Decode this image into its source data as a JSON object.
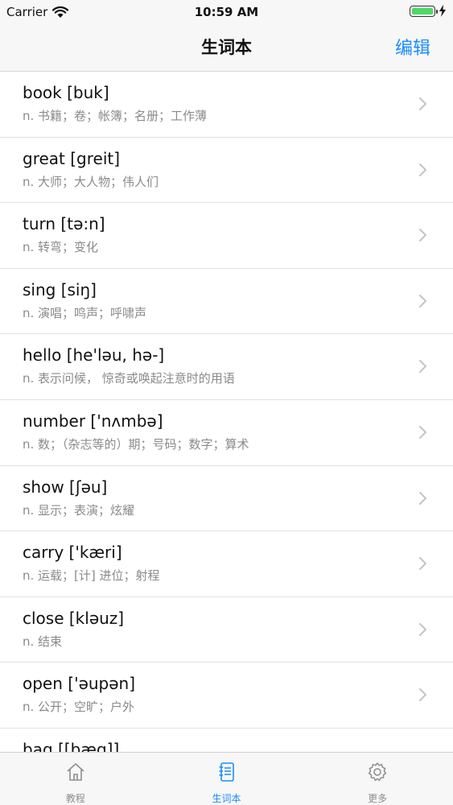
{
  "status_bar": {
    "carrier": "Carrier",
    "time": "10:59 AM"
  },
  "nav": {
    "title": "生词本",
    "edit_label": "编辑"
  },
  "words": [
    {
      "word": "book [buk]",
      "definition": "n. 书籍；卷；帐簿；名册；工作薄"
    },
    {
      "word": "great [greit]",
      "definition": "n. 大师；大人物；伟人们"
    },
    {
      "word": "turn [tə:n]",
      "definition": "n. 转弯；变化"
    },
    {
      "word": "sing [siŋ]",
      "definition": "n. 演唱；鸣声；呼啸声"
    },
    {
      "word": "hello [he'ləu, hə-]",
      "definition": "n. 表示问候， 惊奇或唤起注意时的用语"
    },
    {
      "word": "number ['nʌmbə]",
      "definition": "n. 数；（杂志等的）期；号码；数字；算术"
    },
    {
      "word": "show [ʃəu]",
      "definition": "n. 显示；表演；炫耀"
    },
    {
      "word": "carry ['kæri]",
      "definition": "n. 运载；[计] 进位；射程"
    },
    {
      "word": "close [kləuz]",
      "definition": "n. 结束"
    },
    {
      "word": "open ['əupən]",
      "definition": "n. 公开；空旷；户外"
    },
    {
      "word": "bag [[bæg]]",
      "definition": ""
    }
  ],
  "tabs": [
    {
      "label": "教程",
      "icon": "home-icon",
      "active": false
    },
    {
      "label": "生词本",
      "icon": "notebook-icon",
      "active": true
    },
    {
      "label": "更多",
      "icon": "gear-icon",
      "active": false
    }
  ],
  "colors": {
    "accent": "#1a8cff",
    "battery": "#4cd964",
    "secondary_text": "#8a8a8a"
  }
}
